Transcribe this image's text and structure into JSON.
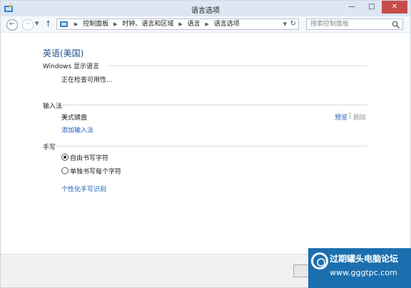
{
  "window": {
    "title": "语言选项"
  },
  "navigation": {
    "breadcrumbs": [
      "控制面板",
      "时钟、语言和区域",
      "语言",
      "语言选项"
    ],
    "search_placeholder": "搜索控制面板"
  },
  "page": {
    "heading": "英语(美国)",
    "display_language": {
      "label": "Windows 显示语言",
      "status": "正在检查可用性..."
    },
    "input_method": {
      "label": "输入法",
      "items": [
        {
          "name": "美式键盘",
          "preview_label": "预览",
          "separator": "|",
          "remove_label": "删除"
        }
      ],
      "add_label": "添加输入法"
    },
    "handwriting": {
      "label": "手写",
      "options": [
        {
          "label": "自由书写字符",
          "selected": true
        },
        {
          "label": "单独书写每个字符",
          "selected": false
        }
      ],
      "personalize_label": "个性化手写识别"
    }
  },
  "watermark": {
    "line1": "过期罐头电脑论坛",
    "line2": "www.gggtpc.com"
  },
  "colors": {
    "titlebar": "#dce7f3",
    "heading": "#1e4e8c",
    "link": "#1e5fb4",
    "close_button": "#c74b4b"
  },
  "icons": [
    "control-panel-icon",
    "back-arrow-icon",
    "forward-arrow-icon",
    "up-arrow-icon",
    "refresh-icon",
    "search-icon",
    "minimize-icon",
    "maximize-icon",
    "close-icon"
  ]
}
